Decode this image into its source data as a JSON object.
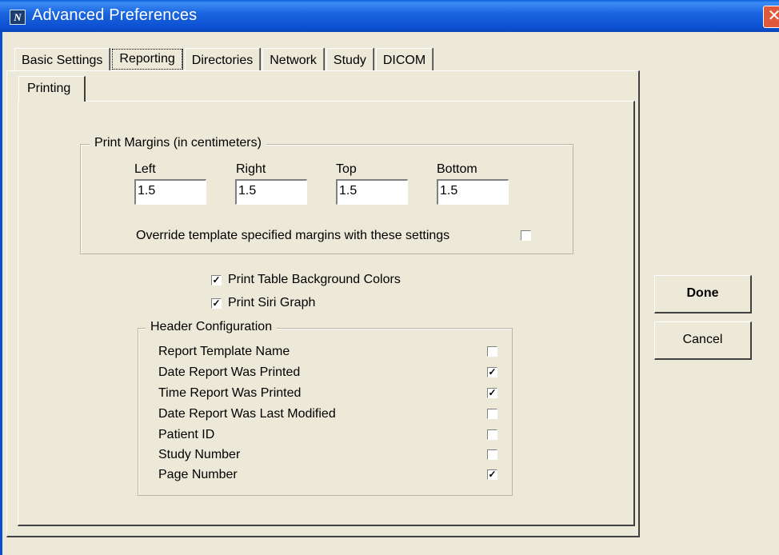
{
  "window": {
    "title": "Advanced Preferences",
    "close_glyph": "✕"
  },
  "tabs": [
    "Basic Settings",
    "Reporting",
    "Directories",
    "Network",
    "Study",
    "DICOM"
  ],
  "subtab": "Printing",
  "margins": {
    "legend": "Print Margins (in centimeters)",
    "left_label": "Left",
    "left_value": "1.5",
    "right_label": "Right",
    "right_value": "1.5",
    "top_label": "Top",
    "top_value": "1.5",
    "bottom_label": "Bottom",
    "bottom_value": "1.5",
    "override_label": "Override template specified margins with these settings",
    "override_checked": false
  },
  "options": [
    {
      "label": "Print Table Background Colors",
      "checked": true
    },
    {
      "label": "Print Siri Graph",
      "checked": true
    }
  ],
  "header_config": {
    "legend": "Header Configuration",
    "items": [
      {
        "label": "Report Template Name",
        "checked": false
      },
      {
        "label": "Date Report Was Printed",
        "checked": true
      },
      {
        "label": "Time Report Was Printed",
        "checked": true
      },
      {
        "label": "Date Report Was Last Modified",
        "checked": false
      },
      {
        "label": "Patient ID",
        "checked": false
      },
      {
        "label": "Study Number",
        "checked": false
      },
      {
        "label": "Page Number",
        "checked": true
      }
    ]
  },
  "buttons": {
    "done": "Done",
    "cancel": "Cancel"
  },
  "check_glyph": "✓"
}
